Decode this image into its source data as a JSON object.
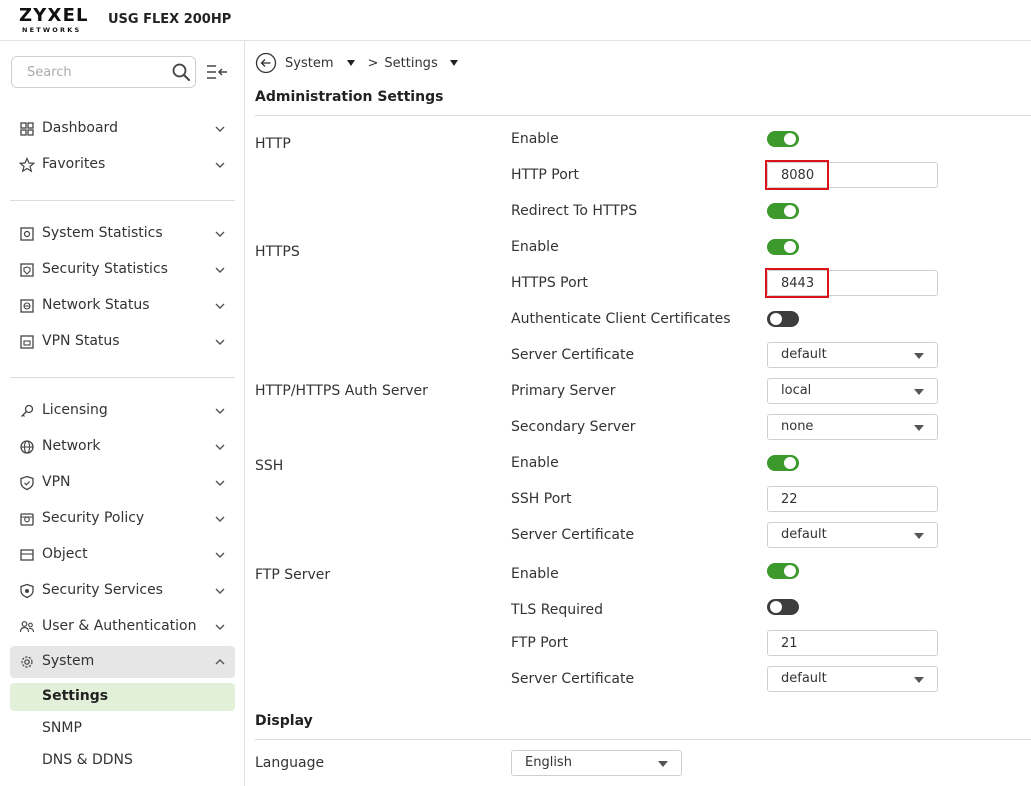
{
  "header": {
    "logo_main": "ZYXEL",
    "logo_sub": "NETWORKS",
    "model": "USG FLEX 200HP"
  },
  "sidebar": {
    "search_placeholder": "Search",
    "items": [
      {
        "label": "Dashboard",
        "icon": "grid-icon"
      },
      {
        "label": "Favorites",
        "icon": "star-icon"
      },
      {
        "label": "System Statistics",
        "icon": "monitor-icon"
      },
      {
        "label": "Security Statistics",
        "icon": "shield-stat-icon"
      },
      {
        "label": "Network Status",
        "icon": "network-status-icon"
      },
      {
        "label": "VPN Status",
        "icon": "vpn-status-icon"
      },
      {
        "label": "Licensing",
        "icon": "key-icon"
      },
      {
        "label": "Network",
        "icon": "globe-icon"
      },
      {
        "label": "VPN",
        "icon": "shield-icon"
      },
      {
        "label": "Security Policy",
        "icon": "policy-icon"
      },
      {
        "label": "Object",
        "icon": "object-icon"
      },
      {
        "label": "Security Services",
        "icon": "security-services-icon"
      },
      {
        "label": "User & Authentication",
        "icon": "users-icon"
      },
      {
        "label": "System",
        "icon": "gear-icon"
      }
    ],
    "subitems": [
      {
        "label": "Settings"
      },
      {
        "label": "SNMP"
      },
      {
        "label": "DNS & DDNS"
      }
    ]
  },
  "breadcrumb": {
    "system": "System",
    "separator": ">",
    "settings": "Settings"
  },
  "admin": {
    "title": "Administration Settings",
    "groups": {
      "http": "HTTP",
      "https": "HTTPS",
      "auth": "HTTP/HTTPS Auth Server",
      "ssh": "SSH",
      "ftp": "FTP Server"
    },
    "fields": {
      "http_enable": {
        "label": "Enable",
        "on": true
      },
      "http_port": {
        "label": "HTTP Port",
        "value": "8080"
      },
      "redirect": {
        "label": "Redirect To HTTPS",
        "on": true
      },
      "https_enable": {
        "label": "Enable",
        "on": true
      },
      "https_port": {
        "label": "HTTPS Port",
        "value": "8443"
      },
      "auth_client": {
        "label": "Authenticate Client Certificates",
        "on": false
      },
      "https_cert": {
        "label": "Server Certificate",
        "value": "default"
      },
      "primary": {
        "label": "Primary Server",
        "value": "local"
      },
      "secondary": {
        "label": "Secondary Server",
        "value": "none"
      },
      "ssh_enable": {
        "label": "Enable",
        "on": true
      },
      "ssh_port": {
        "label": "SSH Port",
        "value": "22"
      },
      "ssh_cert": {
        "label": "Server Certificate",
        "value": "default"
      },
      "ftp_enable": {
        "label": "Enable",
        "on": true
      },
      "tls": {
        "label": "TLS Required",
        "on": false
      },
      "ftp_port": {
        "label": "FTP Port",
        "value": "21"
      },
      "ftp_cert": {
        "label": "Server Certificate",
        "value": "default"
      }
    }
  },
  "display": {
    "title": "Display",
    "language_label": "Language",
    "language_value": "English"
  },
  "colors": {
    "toggle_on": "#3c9a2c",
    "toggle_off": "#3d3d3d",
    "highlight": "#d9141b",
    "selected_bg": "#e3f0d9"
  }
}
